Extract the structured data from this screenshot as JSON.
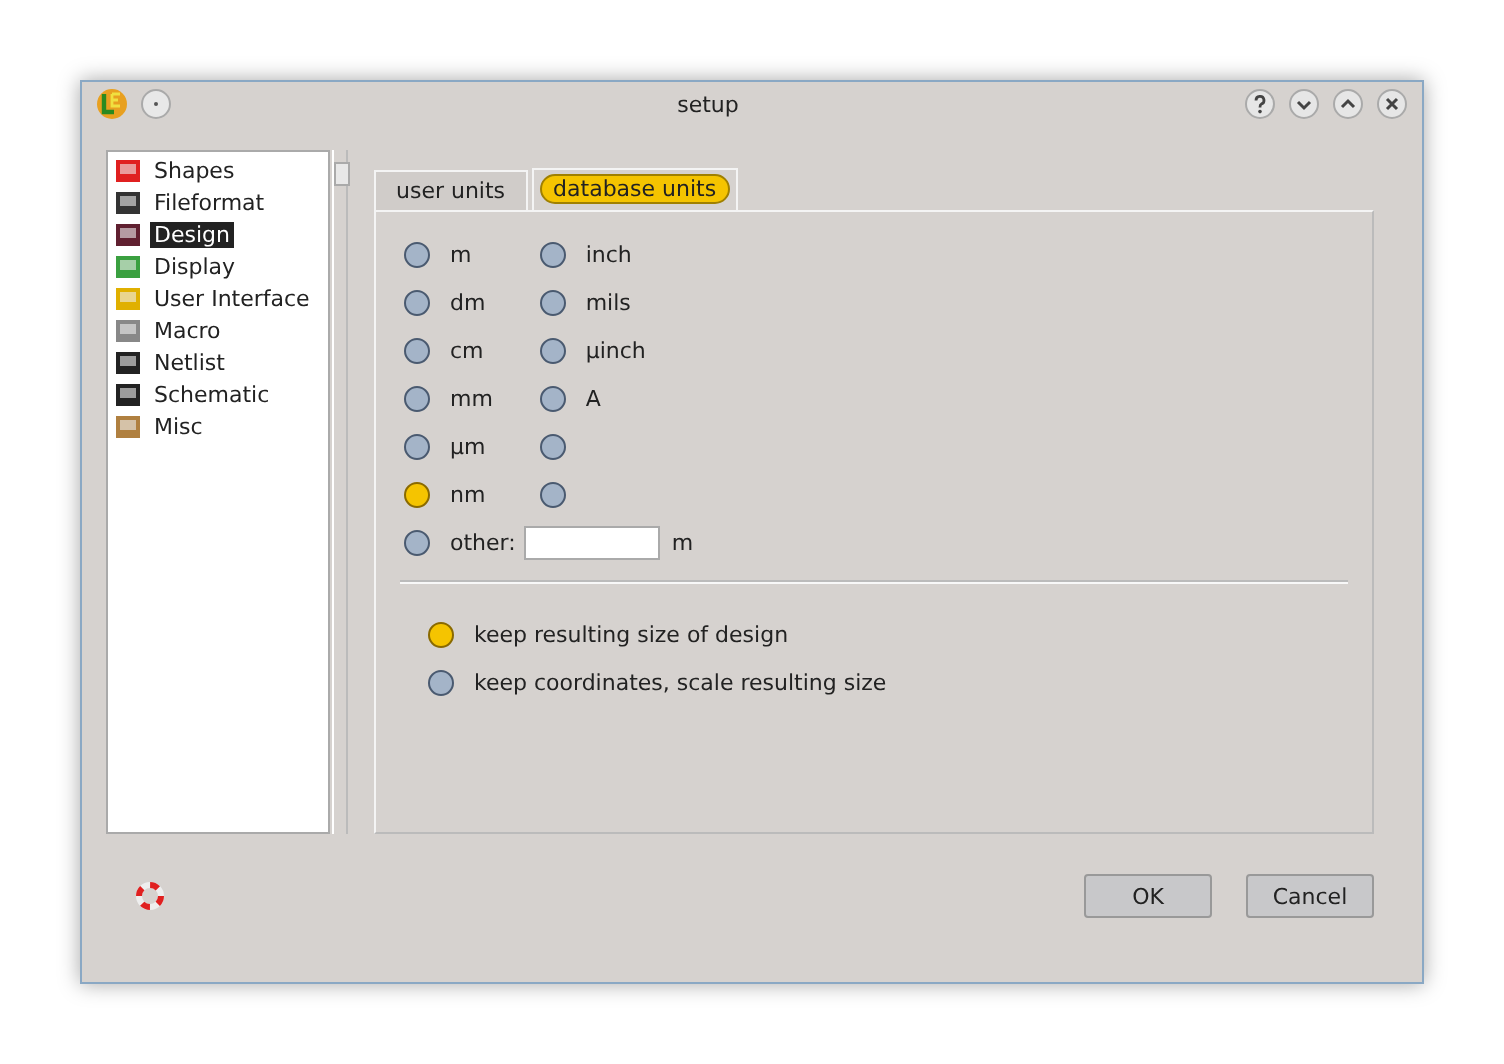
{
  "window": {
    "title": "setup"
  },
  "sidebar": {
    "items": [
      {
        "label": "Shapes",
        "selected": false
      },
      {
        "label": "Fileformat",
        "selected": false
      },
      {
        "label": "Design",
        "selected": true
      },
      {
        "label": "Display",
        "selected": false
      },
      {
        "label": "User Interface",
        "selected": false
      },
      {
        "label": "Macro",
        "selected": false
      },
      {
        "label": "Netlist",
        "selected": false
      },
      {
        "label": "Schematic",
        "selected": false
      },
      {
        "label": "Misc",
        "selected": false
      }
    ]
  },
  "tabs": [
    {
      "label": "user units",
      "selected": false
    },
    {
      "label": "database units",
      "selected": true
    }
  ],
  "units_left": [
    {
      "label": "m",
      "selected": false
    },
    {
      "label": "dm",
      "selected": false
    },
    {
      "label": "cm",
      "selected": false
    },
    {
      "label": "mm",
      "selected": false
    },
    {
      "label": "µm",
      "selected": false
    },
    {
      "label": "nm",
      "selected": true
    },
    {
      "label": "other:",
      "selected": false
    }
  ],
  "units_right": [
    {
      "label": "inch",
      "selected": false
    },
    {
      "label": "mils",
      "selected": false
    },
    {
      "label": "µinch",
      "selected": false
    },
    {
      "label": "A",
      "selected": false
    },
    {
      "selected": false
    },
    {
      "selected": false
    }
  ],
  "other_unit": "m",
  "scale_options": [
    {
      "label": "keep resulting size of design",
      "selected": true
    },
    {
      "label": "keep coordinates, scale resulting size",
      "selected": false
    }
  ],
  "buttons": [
    "OK",
    "Cancel"
  ]
}
